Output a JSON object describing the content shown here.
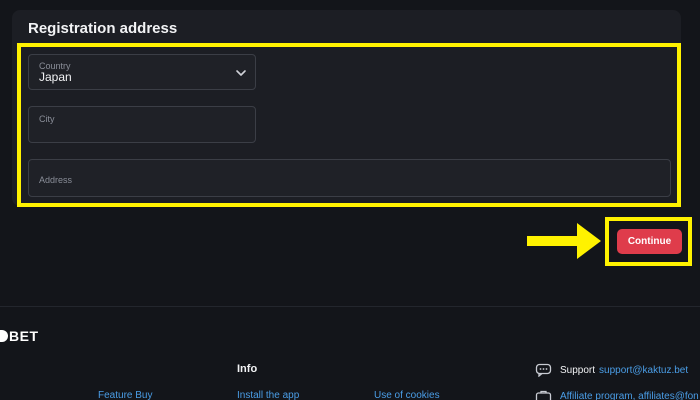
{
  "section": {
    "title": "Registration address"
  },
  "form": {
    "country": {
      "label": "Country",
      "value": "Japan"
    },
    "city": {
      "label": "City",
      "value": ""
    },
    "address": {
      "label": "Address",
      "value": ""
    }
  },
  "actions": {
    "continue_label": "Continue"
  },
  "footer": {
    "logo_text": "BET",
    "info_heading": "Info",
    "links": [
      "Feature Buy",
      "Install the app",
      "Use of cookies"
    ],
    "support": {
      "label": "Support",
      "email": "support@kaktuz.bet"
    },
    "affiliate": {
      "text": "Affiliate program, affiliates@fon"
    }
  },
  "colors": {
    "background": "#13151a",
    "card": "#1c1e24",
    "accent": "#df3c4b",
    "highlight": "#fff200",
    "link": "#4a9de6"
  },
  "icons": [
    "chevron-down-icon",
    "arrow-right-icon",
    "chat-icon",
    "briefcase-icon"
  ]
}
